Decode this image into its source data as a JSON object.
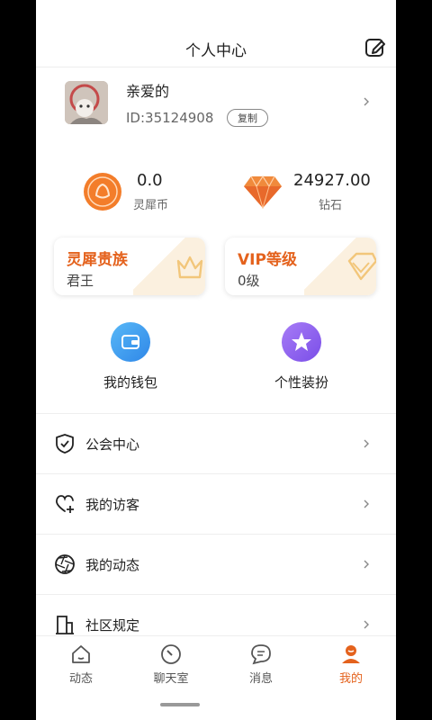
{
  "header": {
    "title": "个人中心"
  },
  "profile": {
    "nickname": "亲爱的",
    "id_text": "ID:35124908",
    "copy_label": "复制"
  },
  "assets": {
    "coin": {
      "value": "0.0",
      "label": "灵犀币"
    },
    "diamond": {
      "value": "24927.00",
      "label": "钻石"
    }
  },
  "cards": {
    "noble": {
      "title": "灵犀贵族",
      "subtitle": "君王"
    },
    "vip": {
      "title": "VIP等级",
      "subtitle": "0级"
    }
  },
  "shortcuts": [
    {
      "label": "我的钱包",
      "icon": "wallet-icon"
    },
    {
      "label": "个性装扮",
      "icon": "star-icon"
    }
  ],
  "menu": [
    {
      "label": "公会中心",
      "icon": "shield-check-icon"
    },
    {
      "label": "我的访客",
      "icon": "heart-plus-icon"
    },
    {
      "label": "我的动态",
      "icon": "aperture-icon"
    },
    {
      "label": "社区规定",
      "icon": "building-icon"
    }
  ],
  "tabs": [
    {
      "label": "动态",
      "icon": "home-icon",
      "active": false
    },
    {
      "label": "聊天室",
      "icon": "compass-icon",
      "active": false
    },
    {
      "label": "消息",
      "icon": "chat-icon",
      "active": false
    },
    {
      "label": "我的",
      "icon": "user-icon",
      "active": true
    }
  ],
  "colors": {
    "accent": "#e4621d",
    "wallet": "#3e9bef",
    "style": "#8b5cf0"
  }
}
